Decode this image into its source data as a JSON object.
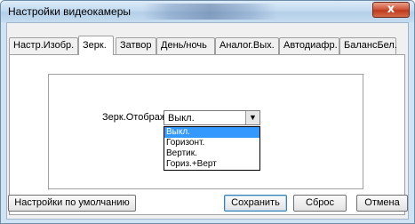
{
  "window": {
    "title": "Настройки видеокамеры",
    "close_glyph": "x",
    "close_icon": "close-icon"
  },
  "tabs": [
    {
      "label": "Настр.Изобр.",
      "active": false
    },
    {
      "label": "Зерк.",
      "active": true
    },
    {
      "label": "Затвор",
      "active": false
    },
    {
      "label": "День/ночь",
      "active": false
    },
    {
      "label": "Аналог.Вых.",
      "active": false
    },
    {
      "label": "Автодиафр.",
      "active": false
    },
    {
      "label": "БалансБел.",
      "active": false
    }
  ],
  "mirror": {
    "label": "Зерк.Отображ.",
    "combo_value": "Выкл.",
    "combo_arrow_icon": "chevron-down-icon",
    "options": [
      "Выкл.",
      "Горизонт.",
      "Вертик.",
      "Гориз.+Верт"
    ],
    "selected_option": "Выкл."
  },
  "buttons": {
    "defaults": "Настройки по умолчанию",
    "save": "Сохранить",
    "reset": "Сброс",
    "cancel": "Отмена"
  },
  "colors": {
    "selection": "#3399ff",
    "close_button": "#c03a1e"
  }
}
